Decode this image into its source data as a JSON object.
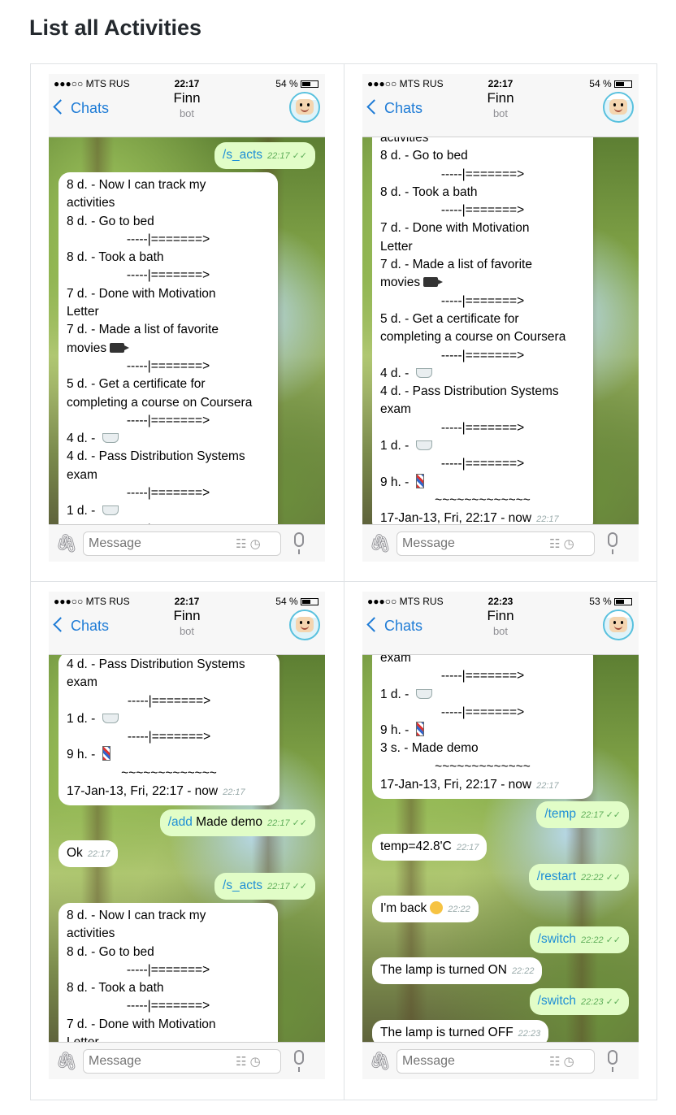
{
  "page": {
    "title": "List all Activities"
  },
  "placeholder": "Message",
  "back_label": "Chats",
  "contact": {
    "name": "Finn",
    "subtitle": "bot"
  },
  "phones": [
    {
      "carrier": "●●●○○ MTS RUS",
      "time": "22:17",
      "battery": "54 %",
      "battery_level": 0.54
    },
    {
      "carrier": "●●●○○ MTS RUS",
      "time": "22:17",
      "battery": "54 %",
      "battery_level": 0.54
    },
    {
      "carrier": "●●●○○ MTS RUS",
      "time": "22:17",
      "battery": "54 %",
      "battery_level": 0.54
    },
    {
      "carrier": "●●●○○ MTS RUS",
      "time": "22:23",
      "battery": "53 %",
      "battery_level": 0.53
    }
  ],
  "activities": {
    "a1": "8 d. - Now I can track my",
    "a1b": "activities",
    "a2": "8 d. - Go to bed",
    "sep": "-----|=======>",
    "a3": "8 d. - Took a bath",
    "a4": "7 d. - Done with Motivation",
    "a4b": "Letter",
    "a5": "7 d. - Made a list of favorite",
    "a5b": "movies",
    "a6": "5 d. - Get a certificate for",
    "a6b": "completing a course on Coursera",
    "a7": "4 d. - ",
    "a8": "4 d. - Pass Distribution Systems",
    "a8b": "exam",
    "a9": "1 d. - ",
    "a10": "9 h. - ",
    "a11": "3 s. - Made demo",
    "tilde": "~~~~~~~~~~~~~",
    "range": "17-Jan-13, Fri, 22:17 - now",
    "cut": "activities",
    "exam": "exam"
  },
  "messages": {
    "s_acts": "/s_acts",
    "add_cmd": "/add",
    "add_text": " Made demo",
    "ok": "Ok",
    "temp": "/temp",
    "temp_reply": "temp=42.8'C",
    "restart": "/restart",
    "back": "I'm back",
    "switch": "/switch",
    "lamp_on": "The lamp is turned ON",
    "lamp_off": "The lamp is turned OFF"
  },
  "times": {
    "t2217": "22:17",
    "t2222": "22:22",
    "t2223": "22:23"
  },
  "icons": {
    "attach": "paperclip-icon",
    "mic": "microphone-icon",
    "movie": "movie-camera-icon",
    "bath": "bathtub-icon",
    "barber": "barber-pole-icon",
    "smile": "smiley-icon",
    "read": "double-check-icon"
  }
}
